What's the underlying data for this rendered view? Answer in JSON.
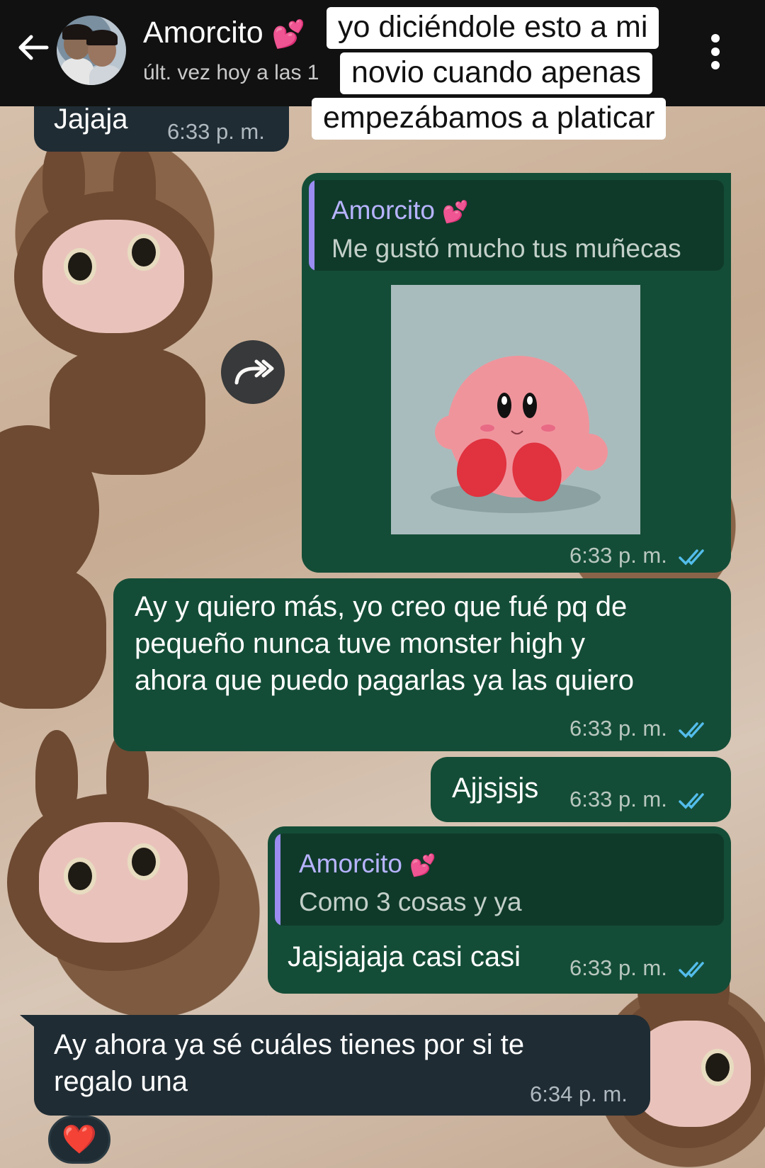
{
  "header": {
    "contact_name": "Amorcito",
    "status": "últ. vez hoy a las 1"
  },
  "caption": {
    "line1": "yo diciéndole esto a mi",
    "line2": "novio cuando apenas",
    "line3": "empezábamos a platicar"
  },
  "messages": [
    {
      "direction": "in",
      "text": "Jajaja",
      "time": "6:33 p. m."
    },
    {
      "direction": "out",
      "reply_author": "Amorcito",
      "reply_text": "Me gustó mucho tus muñecas",
      "media": "kirby-sticker",
      "time": "6:33 p. m.",
      "read": true
    },
    {
      "direction": "out",
      "text_lines": [
        "Ay y quiero más, yo creo que fué pq de",
        "pequeño nunca tuve monster high y",
        "ahora que puedo pagarlas ya las quiero"
      ],
      "time": "6:33 p. m.",
      "read": true
    },
    {
      "direction": "out",
      "text": "Ajjsjsjs",
      "time": "6:33 p. m.",
      "read": true
    },
    {
      "direction": "out",
      "reply_author": "Amorcito",
      "reply_text": "Como 3 cosas y ya",
      "text": "Jajsjajaja casi casi",
      "time": "6:33 p. m.",
      "read": true
    },
    {
      "direction": "in",
      "text_lines": [
        "Ay ahora ya sé cuáles tienes por si te",
        "regalo una"
      ],
      "time": "6:34 p. m.",
      "reaction": "❤️"
    }
  ],
  "icons": {
    "back": "arrow-left-icon",
    "menu": "more-vert-icon",
    "forward": "forward-icon",
    "read": "double-check-icon"
  },
  "colors": {
    "header_bg": "#111111",
    "outgoing_bubble": "#144d37",
    "incoming_bubble": "#1f2c34",
    "read_ticks": "#53bdeb",
    "quote_author": "#b7b3ff"
  }
}
